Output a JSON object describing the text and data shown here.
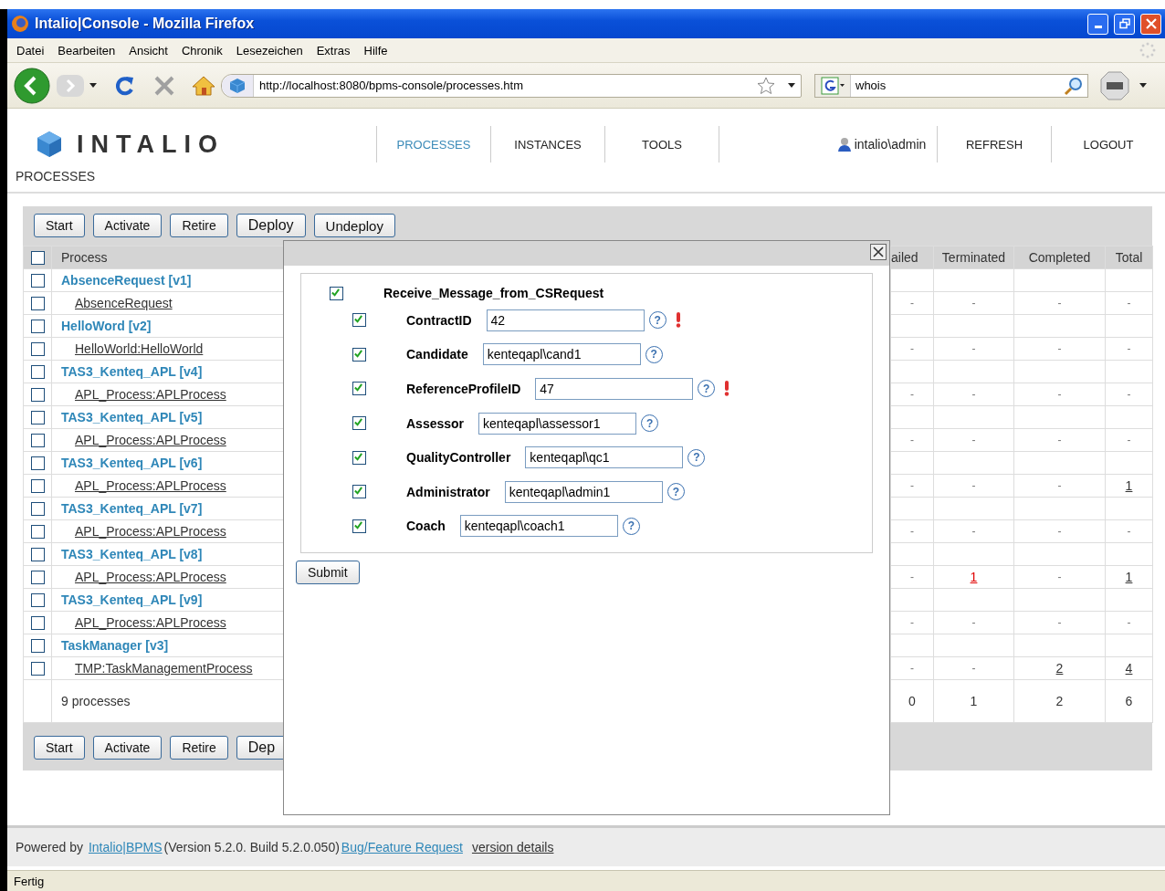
{
  "window": {
    "title": "Intalio|Console - Mozilla Firefox"
  },
  "menu": [
    "Datei",
    "Bearbeiten",
    "Ansicht",
    "Chronik",
    "Lesezeichen",
    "Extras",
    "Hilfe"
  ],
  "toolbar": {
    "url": "http://localhost:8080/bpms-console/processes.htm",
    "search": "whois"
  },
  "app": {
    "logo": "INTALIO",
    "nav": [
      {
        "label": "PROCESSES",
        "selected": true
      },
      {
        "label": "INSTANCES",
        "selected": false
      },
      {
        "label": "TOOLS",
        "selected": false
      }
    ],
    "user": "intalio\\admin",
    "actions": [
      "REFRESH",
      "LOGOUT"
    ],
    "breadcrumb": "PROCESSES"
  },
  "buttons_top": [
    "Start",
    "Activate",
    "Retire",
    "Deploy",
    "Undeploy"
  ],
  "table": {
    "select_all": {
      "checked": false
    },
    "columns": [
      "Process",
      "ailed",
      "Terminated",
      "Completed",
      "Total"
    ],
    "processes": [
      {
        "name": "AbsenceRequest [v1]",
        "checked": false,
        "children": [
          {
            "name": "AbsenceRequest",
            "checked": false,
            "cells": [
              {
                "text": "-",
                "link": false,
                "alert": false
              },
              {
                "text": "-",
                "link": false,
                "alert": false
              },
              {
                "text": "-",
                "link": false,
                "alert": false
              },
              {
                "text": "-",
                "link": false,
                "alert": false
              }
            ]
          }
        ]
      },
      {
        "name": "HelloWord [v2]",
        "checked": false,
        "children": [
          {
            "name": "HelloWorld:HelloWorld",
            "checked": false,
            "cells": [
              {
                "text": "-",
                "link": false,
                "alert": false
              },
              {
                "text": "-",
                "link": false,
                "alert": false
              },
              {
                "text": "-",
                "link": false,
                "alert": false
              },
              {
                "text": "-",
                "link": false,
                "alert": false
              }
            ]
          }
        ]
      },
      {
        "name": "TAS3_Kenteq_APL [v4]",
        "checked": false,
        "children": [
          {
            "name": "APL_Process:APLProcess",
            "checked": false,
            "cells": [
              {
                "text": "-",
                "link": false,
                "alert": false
              },
              {
                "text": "-",
                "link": false,
                "alert": false
              },
              {
                "text": "-",
                "link": false,
                "alert": false
              },
              {
                "text": "-",
                "link": false,
                "alert": false
              }
            ]
          }
        ]
      },
      {
        "name": "TAS3_Kenteq_APL [v5]",
        "checked": false,
        "children": [
          {
            "name": "APL_Process:APLProcess",
            "checked": false,
            "cells": [
              {
                "text": "-",
                "link": false,
                "alert": false
              },
              {
                "text": "-",
                "link": false,
                "alert": false
              },
              {
                "text": "-",
                "link": false,
                "alert": false
              },
              {
                "text": "-",
                "link": false,
                "alert": false
              }
            ]
          }
        ]
      },
      {
        "name": "TAS3_Kenteq_APL [v6]",
        "checked": false,
        "children": [
          {
            "name": "APL_Process:APLProcess",
            "checked": false,
            "cells": [
              {
                "text": "-",
                "link": false,
                "alert": false
              },
              {
                "text": "-",
                "link": false,
                "alert": false
              },
              {
                "text": "-",
                "link": false,
                "alert": false
              },
              {
                "text": "1",
                "link": true,
                "alert": false
              }
            ]
          }
        ]
      },
      {
        "name": "TAS3_Kenteq_APL [v7]",
        "checked": false,
        "children": [
          {
            "name": "APL_Process:APLProcess",
            "checked": false,
            "cells": [
              {
                "text": "-",
                "link": false,
                "alert": false
              },
              {
                "text": "-",
                "link": false,
                "alert": false
              },
              {
                "text": "-",
                "link": false,
                "alert": false
              },
              {
                "text": "-",
                "link": false,
                "alert": false
              }
            ]
          }
        ]
      },
      {
        "name": "TAS3_Kenteq_APL [v8]",
        "checked": false,
        "children": [
          {
            "name": "APL_Process:APLProcess",
            "checked": false,
            "cells": [
              {
                "text": "-",
                "link": false,
                "alert": false
              },
              {
                "text": "1",
                "link": true,
                "alert": true
              },
              {
                "text": "-",
                "link": false,
                "alert": false
              },
              {
                "text": "1",
                "link": true,
                "alert": false
              }
            ]
          }
        ]
      },
      {
        "name": "TAS3_Kenteq_APL [v9]",
        "checked": false,
        "children": [
          {
            "name": "APL_Process:APLProcess",
            "checked": false,
            "cells": [
              {
                "text": "-",
                "link": false,
                "alert": false
              },
              {
                "text": "-",
                "link": false,
                "alert": false
              },
              {
                "text": "-",
                "link": false,
                "alert": false
              },
              {
                "text": "-",
                "link": false,
                "alert": false
              }
            ]
          }
        ]
      },
      {
        "name": "TaskManager [v3]",
        "checked": false,
        "children": [
          {
            "name": "TMP:TaskManagementProcess",
            "checked": false,
            "cells": [
              {
                "text": "-",
                "link": false,
                "alert": false
              },
              {
                "text": "-",
                "link": false,
                "alert": false
              },
              {
                "text": "2",
                "link": true,
                "alert": false
              },
              {
                "text": "4",
                "link": true,
                "alert": false
              }
            ]
          }
        ]
      }
    ],
    "summary": {
      "label": "9 processes",
      "values": [
        "0",
        "1",
        "2",
        "6"
      ]
    }
  },
  "buttons_bottom": [
    "Start",
    "Activate",
    "Retire",
    "Dep"
  ],
  "dialog": {
    "group": {
      "label": "Receive_Message_from_CSRequest",
      "checked": true
    },
    "fields": [
      {
        "label": "ContractID",
        "value": "42",
        "help": "?",
        "checked": true,
        "required": true
      },
      {
        "label": "Candidate",
        "value": "kenteqapl\\cand1",
        "help": "?",
        "checked": true,
        "required": false
      },
      {
        "label": "ReferenceProfileID",
        "value": "47",
        "help": "?",
        "checked": true,
        "required": true
      },
      {
        "label": "Assessor",
        "value": "kenteqapl\\assessor1",
        "help": "?",
        "checked": true,
        "required": false
      },
      {
        "label": "QualityController",
        "value": "kenteqapl\\qc1",
        "help": "?",
        "checked": true,
        "required": false
      },
      {
        "label": "Administrator",
        "value": "kenteqapl\\admin1",
        "help": "?",
        "checked": true,
        "required": false
      },
      {
        "label": "Coach",
        "value": "kenteqapl\\coach1",
        "help": "?",
        "checked": true,
        "required": false
      }
    ],
    "submit": "Submit"
  },
  "footer": {
    "prefix": "Powered by",
    "product": "Intalio|BPMS",
    "version": "(Version 5.2.0. Build 5.2.0.050)",
    "links": [
      "Bug/Feature Request",
      "version details"
    ]
  },
  "status": "Fertig"
}
